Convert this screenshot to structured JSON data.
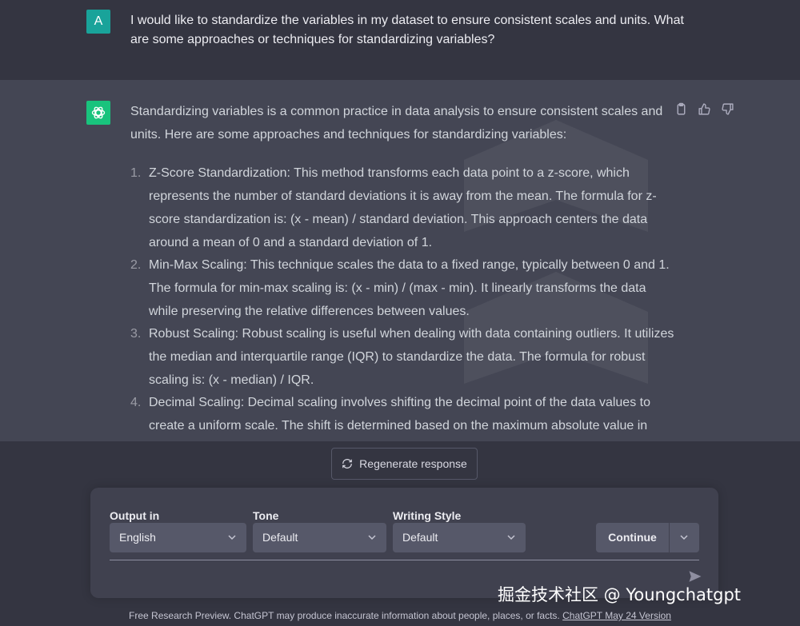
{
  "user": {
    "avatar_letter": "A",
    "message": "I would like to standardize the variables in my dataset to ensure consistent scales and units. What are some approaches or techniques for standardizing variables?"
  },
  "assistant": {
    "avatar_icon": "openai-logo-icon",
    "intro": "Standardizing variables is a common practice in data analysis to ensure consistent scales and units. Here are some approaches and techniques for standardizing variables:",
    "items": [
      {
        "num": "1.",
        "text": "Z-Score Standardization: This method transforms each data point to a z-score, which represents the number of standard deviations it is away from the mean. The formula for z-score standardization is: (x - mean) / standard deviation. This approach centers the data around a mean of 0 and a standard deviation of 1."
      },
      {
        "num": "2.",
        "text": "Min-Max Scaling: This technique scales the data to a fixed range, typically between 0 and 1. The formula for min-max scaling is: (x - min) / (max - min). It linearly transforms the data while preserving the relative differences between values."
      },
      {
        "num": "3.",
        "text": "Robust Scaling: Robust scaling is useful when dealing with data containing outliers. It utilizes the median and interquartile range (IQR) to standardize the data. The formula for robust scaling is: (x - median) / IQR."
      },
      {
        "num": "4.",
        "text": "Decimal Scaling: Decimal scaling involves shifting the decimal point of the data values to create a uniform scale. The shift is determined based on the maximum absolute value in"
      }
    ],
    "actions": [
      "copy-icon",
      "thumbs-up-icon",
      "thumbs-down-icon"
    ]
  },
  "regenerate": {
    "label": "Regenerate response",
    "icon": "refresh-icon"
  },
  "controls": {
    "output_label": "Output in",
    "output_value": "English",
    "tone_label": "Tone",
    "tone_value": "Default",
    "style_label": "Writing Style",
    "style_value": "Default",
    "continue_label": "Continue",
    "send_icon": "send-icon"
  },
  "footer": {
    "text": "Free Research Preview. ChatGPT may produce inaccurate information about people, places, or facts.",
    "link": "ChatGPT May 24 Version"
  },
  "source_mark": "掘金技术社区 @ Youngchatgpt",
  "colors": {
    "background": "#343541",
    "assistant_bg": "#444654",
    "user_avatar": "#19a39a",
    "gpt_avatar": "#19c37d",
    "panel": "#40414f",
    "select": "#565869"
  }
}
